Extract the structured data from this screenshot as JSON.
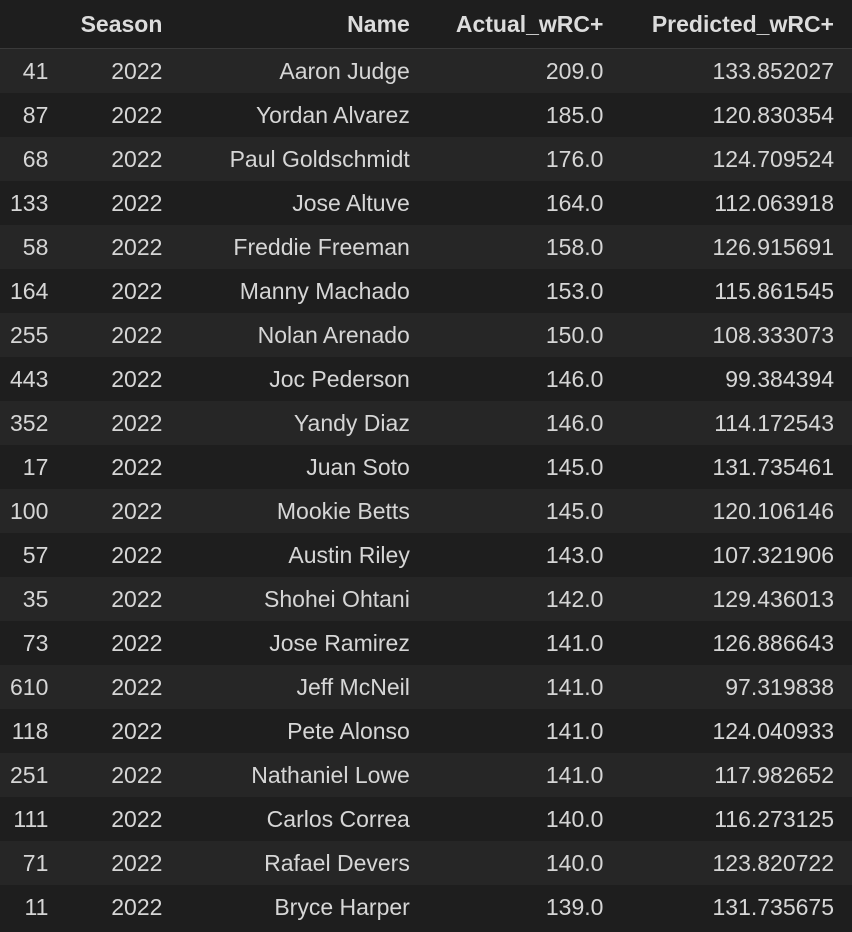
{
  "table": {
    "columns": [
      "",
      "Season",
      "Name",
      "Actual_wRC+",
      "Predicted_wRC+"
    ],
    "rows": [
      {
        "index": "41",
        "season": "2022",
        "name": "Aaron Judge",
        "actual": "209.0",
        "predicted": "133.852027"
      },
      {
        "index": "87",
        "season": "2022",
        "name": "Yordan Alvarez",
        "actual": "185.0",
        "predicted": "120.830354"
      },
      {
        "index": "68",
        "season": "2022",
        "name": "Paul Goldschmidt",
        "actual": "176.0",
        "predicted": "124.709524"
      },
      {
        "index": "133",
        "season": "2022",
        "name": "Jose Altuve",
        "actual": "164.0",
        "predicted": "112.063918"
      },
      {
        "index": "58",
        "season": "2022",
        "name": "Freddie Freeman",
        "actual": "158.0",
        "predicted": "126.915691"
      },
      {
        "index": "164",
        "season": "2022",
        "name": "Manny Machado",
        "actual": "153.0",
        "predicted": "115.861545"
      },
      {
        "index": "255",
        "season": "2022",
        "name": "Nolan Arenado",
        "actual": "150.0",
        "predicted": "108.333073"
      },
      {
        "index": "443",
        "season": "2022",
        "name": "Joc Pederson",
        "actual": "146.0",
        "predicted": "99.384394"
      },
      {
        "index": "352",
        "season": "2022",
        "name": "Yandy Diaz",
        "actual": "146.0",
        "predicted": "114.172543"
      },
      {
        "index": "17",
        "season": "2022",
        "name": "Juan Soto",
        "actual": "145.0",
        "predicted": "131.735461"
      },
      {
        "index": "100",
        "season": "2022",
        "name": "Mookie Betts",
        "actual": "145.0",
        "predicted": "120.106146"
      },
      {
        "index": "57",
        "season": "2022",
        "name": "Austin Riley",
        "actual": "143.0",
        "predicted": "107.321906"
      },
      {
        "index": "35",
        "season": "2022",
        "name": "Shohei Ohtani",
        "actual": "142.0",
        "predicted": "129.436013"
      },
      {
        "index": "73",
        "season": "2022",
        "name": "Jose Ramirez",
        "actual": "141.0",
        "predicted": "126.886643"
      },
      {
        "index": "610",
        "season": "2022",
        "name": "Jeff McNeil",
        "actual": "141.0",
        "predicted": "97.319838"
      },
      {
        "index": "118",
        "season": "2022",
        "name": "Pete Alonso",
        "actual": "141.0",
        "predicted": "124.040933"
      },
      {
        "index": "251",
        "season": "2022",
        "name": "Nathaniel Lowe",
        "actual": "141.0",
        "predicted": "117.982652"
      },
      {
        "index": "111",
        "season": "2022",
        "name": "Carlos Correa",
        "actual": "140.0",
        "predicted": "116.273125"
      },
      {
        "index": "71",
        "season": "2022",
        "name": "Rafael Devers",
        "actual": "140.0",
        "predicted": "123.820722"
      },
      {
        "index": "11",
        "season": "2022",
        "name": "Bryce Harper",
        "actual": "139.0",
        "predicted": "131.735675"
      }
    ]
  }
}
